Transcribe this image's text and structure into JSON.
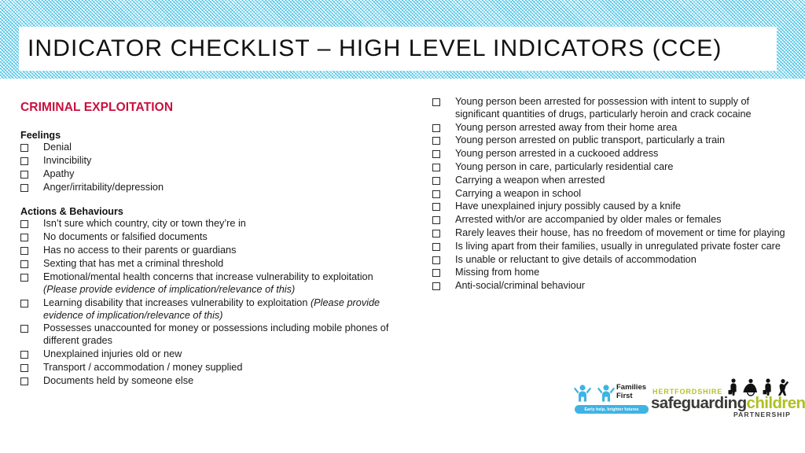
{
  "header": {
    "title": "INDICATOR CHECKLIST – HIGH LEVEL INDICATORS (CCE)",
    "band_color": "#29B6DE",
    "box_color": "#FFFFFF"
  },
  "left_column": {
    "section_title": "CRIMINAL EXPLOITATION",
    "section_title_color": "#C8103E",
    "groups": [
      {
        "title": "Feelings",
        "items": [
          {
            "text": "Denial"
          },
          {
            "text": "Invincibility"
          },
          {
            "text": "Apathy"
          },
          {
            "text": "Anger/irritability/depression"
          }
        ]
      },
      {
        "title": "Actions & Behaviours",
        "items": [
          {
            "text": "Isn’t sure which country, city or town they’re in"
          },
          {
            "text": "No documents or falsified documents"
          },
          {
            "text": "Has no access to their parents or guardians"
          },
          {
            "text": "Sexting that has met a criminal threshold"
          },
          {
            "text": "Emotional/mental health concerns that increase vulnerability to exploitation ",
            "italic": "(Please provide evidence of implication/relevance of this)"
          },
          {
            "text": "Learning disability that increases vulnerability to exploitation ",
            "italic": "(Please provide evidence of implication/relevance of this)"
          },
          {
            "text": "Possesses unaccounted for money or possessions including mobile phones of different grades"
          },
          {
            "text": "Unexplained injuries old or new"
          },
          {
            "text": "Transport / accommodation / money supplied"
          },
          {
            "text": "Documents held by someone else"
          }
        ]
      }
    ]
  },
  "right_column": {
    "items": [
      {
        "text": "Young person been arrested for possession with intent to supply of significant quantities of drugs, particularly heroin and crack cocaine"
      },
      {
        "text": "Young person arrested away from their home area"
      },
      {
        "text": "Young person arrested on public transport, particularly a train"
      },
      {
        "text": "Young person arrested in a cuckooed address"
      },
      {
        "text": "Young person in care, particularly residential care"
      },
      {
        "text": "Carrying a weapon when arrested"
      },
      {
        "text": "Carrying a weapon in school"
      },
      {
        "text": "Have unexplained injury possibly caused by a knife"
      },
      {
        "text": "Arrested with/or are accompanied by older males or females"
      },
      {
        "text": "Rarely leaves their house, has no freedom of movement or time for playing"
      },
      {
        "text": "Is living apart from their families, usually in unregulated private foster care"
      },
      {
        "text": "Is unable or reluctant to give details of accommodation"
      },
      {
        "text": "Missing from home"
      },
      {
        "text": "Anti-social/criminal behaviour"
      }
    ]
  },
  "logos": {
    "families_first": {
      "name_line1": "Families",
      "name_line2": "First",
      "tagline": "Early help, brighter futures",
      "color": "#3FB3E3"
    },
    "safeguarding_children": {
      "top_word": "HERTFORDSHIRE",
      "word1": "safeguarding",
      "word2": "children",
      "bottom_word": "PARTNERSHIP",
      "green": "#AFC022",
      "dark": "#3A3A38"
    }
  }
}
